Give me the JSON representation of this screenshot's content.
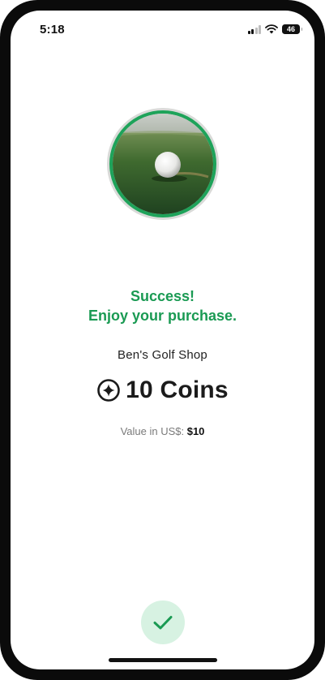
{
  "status_bar": {
    "time": "5:18",
    "battery": "46",
    "icons": [
      "cellular-signal-icon",
      "wifi-icon",
      "battery-icon"
    ]
  },
  "receipt": {
    "image": "golf-ball-on-grass",
    "success_line1": "Success!",
    "success_line2": "Enjoy your purchase.",
    "merchant": "Ben's Golf Shop",
    "coin_icon": "coin-star-icon",
    "amount": "10 Coins",
    "value_label": "Value in US$:",
    "value_amount": "$10"
  },
  "actions": {
    "done_icon": "checkmark-icon"
  },
  "colors": {
    "accent_green": "#1a9a53",
    "button_bg": "#d7f2e2",
    "ring_green": "#1ea35a"
  }
}
